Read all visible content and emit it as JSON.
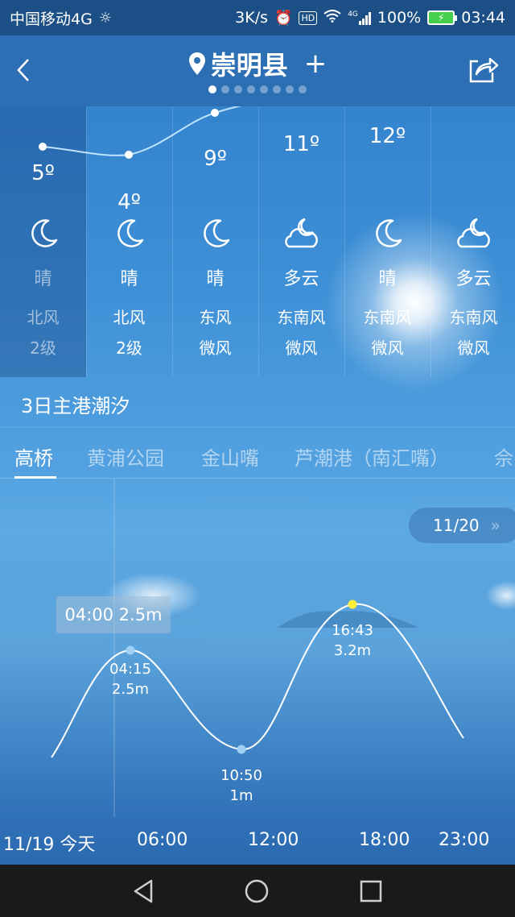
{
  "status_bar": {
    "carrier": "中国移动4G",
    "speed": "3K/s",
    "hd": "HD",
    "signal": "4G",
    "battery": "100%",
    "time": "03:44"
  },
  "header": {
    "city": "崇明县",
    "add_symbol": "+",
    "page_dots": 8,
    "active_dot": 0
  },
  "forecast": [
    {
      "temp": "5º",
      "temp_value": 5,
      "icon": "moon-icon",
      "condition": "晴",
      "wind": "北风",
      "level": "2级",
      "past": true
    },
    {
      "temp": "4º",
      "temp_value": 4,
      "icon": "moon-icon",
      "condition": "晴",
      "wind": "北风",
      "level": "2级",
      "past": false
    },
    {
      "temp": "9º",
      "temp_value": 9,
      "icon": "moon-icon",
      "condition": "晴",
      "wind": "东风",
      "level": "微风",
      "past": false
    },
    {
      "temp": "11º",
      "temp_value": 11,
      "icon": "cloudy-night-icon",
      "condition": "多云",
      "wind": "东南风",
      "level": "微风",
      "past": false
    },
    {
      "temp": "12º",
      "temp_value": 12,
      "icon": "moon-icon",
      "condition": "晴",
      "wind": "东南风",
      "level": "微风",
      "past": false
    },
    {
      "temp": "",
      "temp_value": null,
      "icon": "cloudy-night-icon",
      "condition": "多云",
      "wind": "东南风",
      "level": "微风",
      "past": false
    }
  ],
  "tide": {
    "section_title": "3日主港潮汐",
    "tabs": [
      "高桥",
      "黄浦公园",
      "金山嘴",
      "芦潮港（南汇嘴）",
      "佘"
    ],
    "active_tab": 0,
    "next_date": "11/20",
    "next_arrow": "»",
    "tooltip": "04:00 2.5m",
    "points": [
      {
        "time": "04:15",
        "height": "2.5m",
        "type": "high"
      },
      {
        "time": "10:50",
        "height": "1m",
        "type": "low"
      },
      {
        "time": "16:43",
        "height": "3.2m",
        "type": "high"
      }
    ],
    "x_axis": [
      "11/19 今天",
      "06:00",
      "12:00",
      "18:00",
      "23:00"
    ]
  },
  "colors": {
    "accent_dot": "#ffee3a",
    "curve": "#ffffff",
    "point": "#9fd1f5"
  }
}
